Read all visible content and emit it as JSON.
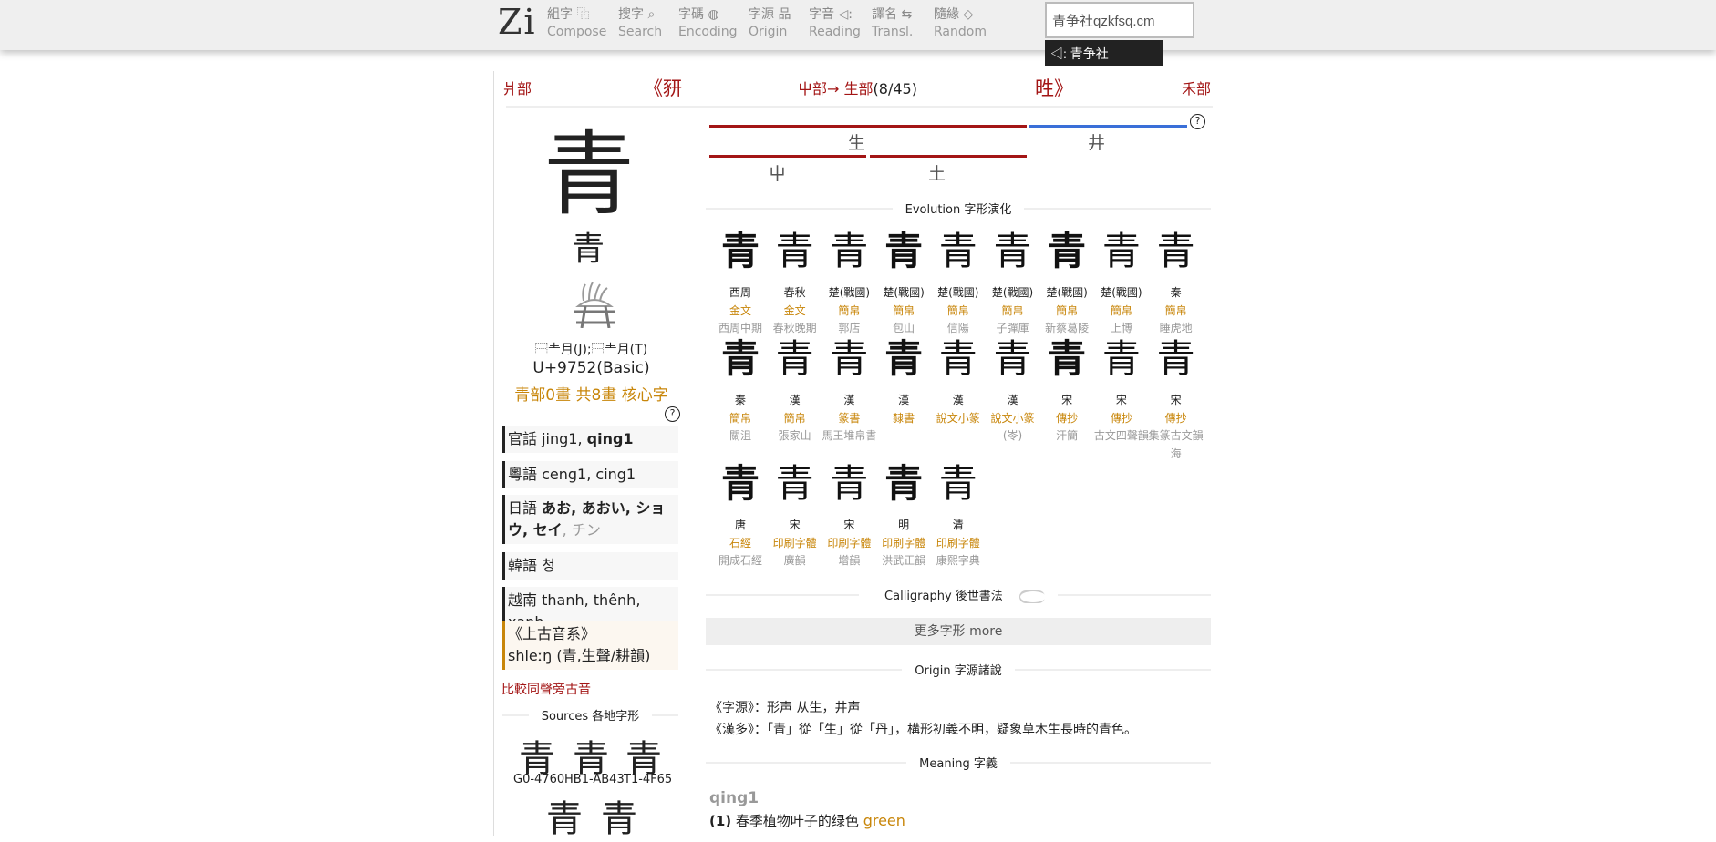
{
  "topbar": {
    "logo": "Zi",
    "nav": [
      {
        "zh": "組字 ⿻",
        "en": "Compose"
      },
      {
        "zh": "搜字 ⌕",
        "en": "Search"
      },
      {
        "zh": "字碼 ◍",
        "en": "Encoding"
      },
      {
        "zh": "字源 品",
        "en": "Origin"
      },
      {
        "zh": "字音 ◁:",
        "en": "Reading"
      },
      {
        "zh": "譯名 ⇆",
        "en": "Transl."
      },
      {
        "zh": "隨緣 ◇",
        "en": "Random"
      }
    ],
    "search_value": "青争社qzkfsq.cm",
    "tooltip": "◁: 青争社qzkfsq.cm"
  },
  "radical_nav": {
    "prev_radical": "爿部",
    "prev_char": "《豜",
    "path_from": "屮部→ ",
    "path_to": "生部",
    "path_count": "(8/45)",
    "next_char": "甠》",
    "next_radical": "禾部"
  },
  "decomposition": {
    "top_left": "生",
    "top_right": "井",
    "bottom_left": "屮",
    "bottom_mid": "土",
    "help": "?",
    "colors": {
      "phonetic_semantic": "#a31515",
      "phonetic": "#3a6fd8"
    }
  },
  "character": {
    "main": "青",
    "seal": "青",
    "ids": "⿱龶月(J);⿱龶月(T)",
    "unicode": "U+9752(Basic)",
    "strokes": "青部0畫 共8畫 核心字",
    "help": "?"
  },
  "readings": [
    {
      "lang": "官話",
      "plain": " jing1, ",
      "bold": "qing1",
      "dim": ""
    },
    {
      "lang": "粵語",
      "plain": " ceng1, cing1",
      "bold": "",
      "dim": ""
    },
    {
      "lang": "日語",
      "plain": " ",
      "bold": "あお, あおい, ショウ, セイ",
      "dim": ", チン"
    },
    {
      "lang": "韓語",
      "plain": " 청",
      "bold": "",
      "dim": ""
    },
    {
      "lang": "越南",
      "plain": " thanh, thênh, xanh",
      "bold": "",
      "dim": ""
    }
  ],
  "old_chinese": {
    "title": "《上古音系》",
    "value": "shleːŋ (青,生聲/耕韻)"
  },
  "compare_link": "比較同聲旁古音",
  "sources": {
    "title": "Sources 各地字形",
    "glyph": "青",
    "labels": [
      "G0-4760",
      "HB1-AB43",
      "T1-4F65"
    ]
  },
  "evolution": {
    "title": "Evolution 字形演化",
    "items": [
      {
        "era": "西周",
        "script": "金文",
        "src": "西周中期"
      },
      {
        "era": "春秋",
        "script": "金文",
        "src": "春秋晚期"
      },
      {
        "era": "楚(戰國)",
        "script": "簡帛",
        "src": "郭店"
      },
      {
        "era": "楚(戰國)",
        "script": "簡帛",
        "src": "包山"
      },
      {
        "era": "楚(戰國)",
        "script": "簡帛",
        "src": "信陽"
      },
      {
        "era": "楚(戰國)",
        "script": "簡帛",
        "src": "子彈庫"
      },
      {
        "era": "楚(戰國)",
        "script": "簡帛",
        "src": "新蔡葛陵"
      },
      {
        "era": "楚(戰國)",
        "script": "簡帛",
        "src": "上博"
      },
      {
        "era": "秦",
        "script": "簡帛",
        "src": "睡虎地"
      },
      {
        "era": "秦",
        "script": "簡帛",
        "src": "關沮"
      },
      {
        "era": "漢",
        "script": "簡帛",
        "src": "張家山"
      },
      {
        "era": "漢",
        "script": "篆書",
        "src": "馬王堆帛書"
      },
      {
        "era": "漢",
        "script": "隸書",
        "src": ""
      },
      {
        "era": "漢",
        "script": "說文小篆",
        "src": ""
      },
      {
        "era": "漢",
        "script": "說文小篆",
        "src": "(岺)"
      },
      {
        "era": "宋",
        "script": "傳抄",
        "src": "汗簡"
      },
      {
        "era": "宋",
        "script": "傳抄",
        "src": "古文四聲韻"
      },
      {
        "era": "宋",
        "script": "傳抄",
        "src": "集篆古文韻海"
      },
      {
        "era": "唐",
        "script": "石經",
        "src": "開成石經"
      },
      {
        "era": "宋",
        "script": "印刷字體",
        "src": "廣韻"
      },
      {
        "era": "宋",
        "script": "印刷字體",
        "src": "增韻"
      },
      {
        "era": "明",
        "script": "印刷字體",
        "src": "洪武正韻"
      },
      {
        "era": "清",
        "script": "印刷字體",
        "src": "康熙字典"
      }
    ]
  },
  "calligraphy": {
    "title": "Calligraphy 後世書法",
    "toggle_on": false
  },
  "more_button": "更多字形 more",
  "origin": {
    "title": "Origin 字源諸說",
    "lines": [
      "《字源》：形声 从生，井声",
      "《漢多》：「青」從「生」從「丹」，構形初義不明，疑象草木生長時的青色。"
    ]
  },
  "meaning": {
    "title": "Meaning 字義",
    "reading": "qing1",
    "num": "(1)",
    "text": " 春季植物叶子的绿色 ",
    "en": "green"
  }
}
